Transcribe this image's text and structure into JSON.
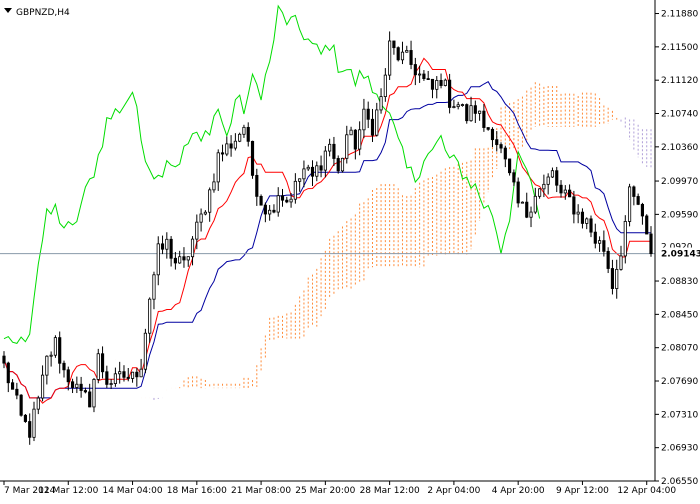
{
  "window": {
    "title": "GBPNZD,H4"
  },
  "chart_data": {
    "type": "candlestick",
    "symbol": "GBPNZD",
    "timeframe": "H4",
    "title": "GBPNZD,H4",
    "current_price": 2.09143,
    "current_price_label": "2.09143",
    "hidden_label_fragment": "2.0920",
    "ylim": [
      2.0655,
      2.12
    ],
    "y_ticks": [
      {
        "value": 2.1188,
        "label": "2.11880"
      },
      {
        "value": 2.115,
        "label": "2.11500"
      },
      {
        "value": 2.1112,
        "label": "2.11120"
      },
      {
        "value": 2.1074,
        "label": "2.10740"
      },
      {
        "value": 2.1036,
        "label": "2.10360"
      },
      {
        "value": 2.0997,
        "label": "2.09970"
      },
      {
        "value": 2.0959,
        "label": "2.09590"
      },
      {
        "value": 2.0883,
        "label": "2.08830"
      },
      {
        "value": 2.0845,
        "label": "2.08450"
      },
      {
        "value": 2.0807,
        "label": "2.08070"
      },
      {
        "value": 2.0769,
        "label": "2.07690"
      },
      {
        "value": 2.0731,
        "label": "2.07310"
      },
      {
        "value": 2.0693,
        "label": "2.06930"
      },
      {
        "value": 2.0655,
        "label": "2.06550"
      }
    ],
    "x_ticks": [
      {
        "index": 0,
        "label": "7 Mar 2024"
      },
      {
        "index": 15,
        "label": "11 Mar 12:00"
      },
      {
        "index": 30,
        "label": "14 Mar 04:00"
      },
      {
        "index": 45,
        "label": "18 Mar 16:00"
      },
      {
        "index": 60,
        "label": "21 Mar 08:00"
      },
      {
        "index": 75,
        "label": "25 Mar 20:00"
      },
      {
        "index": 90,
        "label": "28 Mar 12:00"
      },
      {
        "index": 105,
        "label": "2 Apr 04:00"
      },
      {
        "index": 120,
        "label": "4 Apr 20:00"
      },
      {
        "index": 135,
        "label": "9 Apr 12:00"
      },
      {
        "index": 150,
        "label": "12 Apr 04:00"
      }
    ],
    "bar_count": 152,
    "indicator": "Ichimoku Kinko Hyo",
    "colors": {
      "background": "#ffffff",
      "candle": "#000000",
      "tenkan": "#ff0000",
      "kijun": "#0000a0",
      "chikou": "#00dd00",
      "kumo_bull": "#ff8c3a",
      "kumo_bear": "#b0a0d8",
      "price_line": "#8899aa"
    },
    "close_anchors": [
      [
        0,
        2.0786
      ],
      [
        3,
        2.0742
      ],
      [
        4,
        2.0726
      ],
      [
        6,
        2.0712
      ],
      [
        8,
        2.0745
      ],
      [
        10,
        2.0792
      ],
      [
        12,
        2.0812
      ],
      [
        14,
        2.078
      ],
      [
        16,
        2.0768
      ],
      [
        18,
        2.075
      ],
      [
        20,
        2.0748
      ],
      [
        22,
        2.0795
      ],
      [
        24,
        2.077
      ],
      [
        26,
        2.0768
      ],
      [
        28,
        2.0775
      ],
      [
        30,
        2.0772
      ],
      [
        32,
        2.079
      ],
      [
        34,
        2.0865
      ],
      [
        36,
        2.0915
      ],
      [
        38,
        2.0925
      ],
      [
        40,
        2.0905
      ],
      [
        42,
        2.09
      ],
      [
        44,
        2.093
      ],
      [
        46,
        2.0955
      ],
      [
        48,
        2.0985
      ],
      [
        50,
        2.1025
      ],
      [
        52,
        2.1035
      ],
      [
        54,
        2.1045
      ],
      [
        56,
        2.106
      ],
      [
        58,
        2.1005
      ],
      [
        60,
        2.0975
      ],
      [
        62,
        2.096
      ],
      [
        64,
        2.0985
      ],
      [
        66,
        2.0975
      ],
      [
        68,
        2.099
      ],
      [
        70,
        2.101
      ],
      [
        72,
        2.1
      ],
      [
        74,
        2.102
      ],
      [
        76,
        2.104
      ],
      [
        78,
        2.1005
      ],
      [
        80,
        2.105
      ],
      [
        82,
        2.104
      ],
      [
        84,
        2.107
      ],
      [
        86,
        2.106
      ],
      [
        88,
        2.109
      ],
      [
        90,
        2.115
      ],
      [
        92,
        2.114
      ],
      [
        94,
        2.1135
      ],
      [
        96,
        2.1125
      ],
      [
        98,
        2.111
      ],
      [
        100,
        2.11
      ],
      [
        102,
        2.1115
      ],
      [
        104,
        2.109
      ],
      [
        106,
        2.1085
      ],
      [
        108,
        2.107
      ],
      [
        110,
        2.108
      ],
      [
        112,
        2.106
      ],
      [
        114,
        2.1055
      ],
      [
        116,
        2.103
      ],
      [
        118,
        2.1
      ],
      [
        120,
        2.097
      ],
      [
        122,
        2.096
      ],
      [
        124,
        2.0985
      ],
      [
        126,
        2.099
      ],
      [
        128,
        2.1005
      ],
      [
        130,
        2.098
      ],
      [
        132,
        2.0975
      ],
      [
        134,
        2.096
      ],
      [
        136,
        2.095
      ],
      [
        138,
        2.093
      ],
      [
        140,
        2.092
      ],
      [
        142,
        2.088
      ],
      [
        144,
        2.092
      ],
      [
        146,
        2.098
      ],
      [
        148,
        2.097
      ],
      [
        150,
        2.093
      ],
      [
        151,
        2.0914
      ]
    ]
  }
}
